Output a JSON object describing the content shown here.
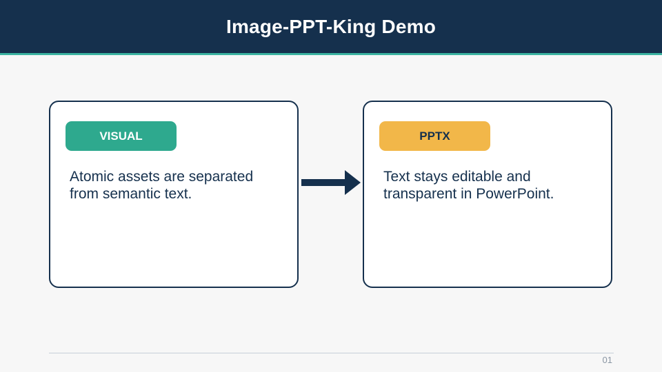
{
  "slide": {
    "title": "Image-PPT-King Demo",
    "page_number": "01"
  },
  "cards": [
    {
      "badge": "VISUAL",
      "text": "Atomic assets are separated from semantic text."
    },
    {
      "badge": "PPTX",
      "text": "Text stays editable and transparent in PowerPoint."
    }
  ],
  "colors": {
    "header_background": "#15304d",
    "header_accent": "#3bb3a1",
    "visual_badge": "#2ea98e",
    "pptx_badge": "#f2b749",
    "card_border": "#15304d",
    "arrow": "#15304d"
  },
  "icons": {
    "connector": "arrow-right-icon"
  }
}
